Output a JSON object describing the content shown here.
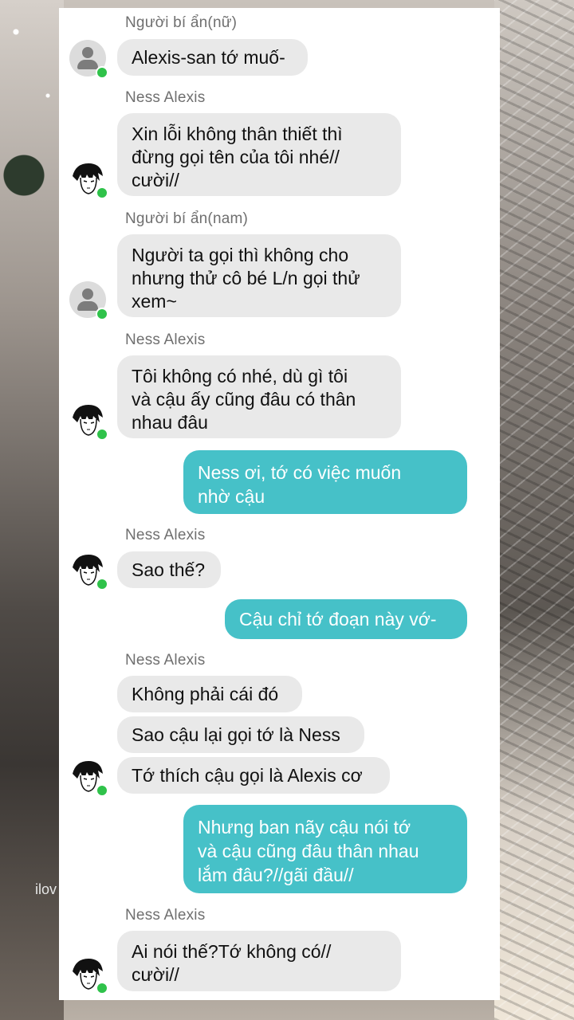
{
  "background": {
    "watermark": "ilov"
  },
  "messages": [
    {
      "sender": "Người bí ẩn(nữ)",
      "lines": [
        "Alexis-san tớ muố-"
      ]
    },
    {
      "sender": "Ness Alexis",
      "lines": [
        "Xin lỗi không thân thiết thì\nđừng gọi tên của tôi nhé//\ncười//"
      ]
    },
    {
      "sender": "Người bí ẩn(nam)",
      "lines": [
        "Người ta gọi thì không cho\nnhưng thử cô bé L/n gọi thử\nxem~"
      ]
    },
    {
      "sender": "Ness Alexis",
      "lines": [
        "Tôi không có nhé, dù gì tôi\nvà cậu ấy cũng đâu có thân\nnhau đâu"
      ]
    },
    {
      "mine": "Ness ơi, tớ có việc muốn\nnhờ cậu"
    },
    {
      "sender": "Ness Alexis",
      "lines": [
        "Sao thế?"
      ]
    },
    {
      "mine": "Cậu chỉ tớ đoạn này vớ-"
    },
    {
      "sender": "Ness Alexis",
      "lines": [
        "Không phải cái đó",
        "Sao cậu lại gọi tớ là Ness",
        "Tớ thích cậu gọi là Alexis cơ"
      ]
    },
    {
      "mine": "Nhưng ban nãy cậu nói tớ\nvà cậu cũng đâu thân nhau\nlắm đâu?//gãi đầu//"
    },
    {
      "sender": "Ness Alexis",
      "lines": [
        "Ai nói thế?Tớ không có//\ncười//"
      ]
    }
  ],
  "colors": {
    "mine_bubble": "#46c1c8",
    "their_bubble": "#e9e9e9",
    "online_dot": "#2fc24a"
  }
}
